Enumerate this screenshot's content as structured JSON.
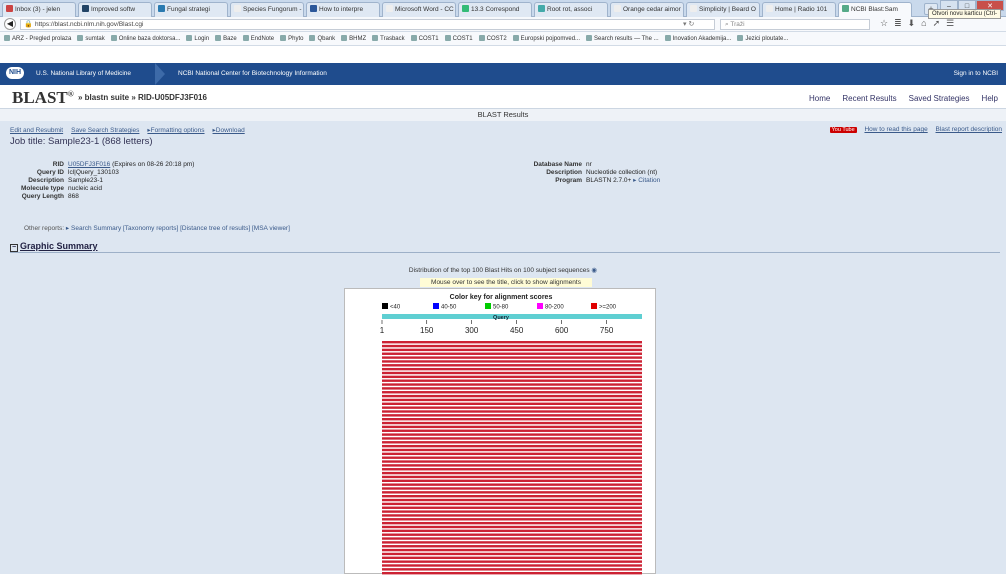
{
  "browser": {
    "tabs": [
      {
        "label": "Inbox (3) - jelen",
        "color": "#c44"
      },
      {
        "label": "Improved softw",
        "color": "#246"
      },
      {
        "label": "Fungal strategi",
        "color": "#2a7ab0"
      },
      {
        "label": "Species Fungorum -",
        "color": "#eee"
      },
      {
        "label": "How to interpre",
        "color": "#2b579a"
      },
      {
        "label": "Microsoft Word - CC",
        "color": "#eee"
      },
      {
        "label": "13.3 Correspond",
        "color": "#3b7"
      },
      {
        "label": "Root rot, associ",
        "color": "#4aa"
      },
      {
        "label": "Orange cedar aimor",
        "color": "#eee"
      },
      {
        "label": "Simplicity | Beard O",
        "color": "#eee"
      },
      {
        "label": "Home | Radio 101",
        "color": "#eee"
      },
      {
        "label": "NCBI Blast:Sam",
        "color": "#5a8"
      }
    ],
    "new_tab": "+",
    "tooltip": "Otvori novu karticu (Ctrl-",
    "url": "https://blast.ncbi.nlm.nih.gov/Blast.cgi",
    "search_placeholder": "Traži",
    "bookmarks": [
      "ARZ - Pregled prolaza",
      "sumtak",
      "Online baza doktorsa...",
      "Login",
      "Baze",
      "EndNote",
      "Phyto",
      "Qbank",
      "BHMZ",
      "Trasback",
      "COST1",
      "COST1",
      "COST2",
      "Europski pojpomved...",
      "Search results — The ...",
      "Inovation Akademija...",
      "Jezici ploutate..."
    ]
  },
  "ncbi": {
    "nih": "NIH",
    "nlm": "U.S. National Library of Medicine",
    "ncbi": "NCBI  National Center for Biotechnology Information",
    "signin": "Sign in to NCBI"
  },
  "blast": {
    "logo": "BLAST",
    "logo_sup": "®",
    "crumbs": "» blastn suite » RID-U05DFJ3F016",
    "links": [
      "Home",
      "Recent Results",
      "Saved Strategies",
      "Help"
    ],
    "results_title": "BLAST Results"
  },
  "content": {
    "actions": [
      "Edit and Resubmit",
      "Save Search Strategies",
      "▸Formatting options",
      "▸Download"
    ],
    "yt": "You Tube",
    "howto": "How to read this page",
    "blastreport": "Blast report description",
    "job_title": "Job title: Sample23-1 (868 letters)",
    "left_info": [
      {
        "k": "RID",
        "v": "U05DFJ3F016",
        "extra": " (Expires on 08-26 20:18 pm)"
      },
      {
        "k": "Query ID",
        "v": "lcl|Query_130103"
      },
      {
        "k": "Description",
        "v": "Sample23-1"
      },
      {
        "k": "Molecule type",
        "v": "nucleic acid"
      },
      {
        "k": "Query Length",
        "v": "868"
      }
    ],
    "right_info": [
      {
        "k": "Database Name",
        "v": "nr"
      },
      {
        "k": "Description",
        "v": "Nucleotide collection (nt)"
      },
      {
        "k": "Program",
        "v": "BLASTN 2.7.0+",
        "extra": " ▸ Citation"
      }
    ],
    "other_label": "Other reports:",
    "other_links": "▸ Search Summary [Taxonomy reports] [Distance tree of results] [MSA viewer]",
    "graphic_summary": "Graphic Summary",
    "distribution": "Distribution of the top 100 Blast Hits on 100 subject sequences",
    "mouse_over": "Mouse over to see the title, click to show alignments"
  },
  "chart_data": {
    "type": "bar",
    "title": "Color key for alignment scores",
    "key": [
      {
        "label": "<40",
        "color": "#000000"
      },
      {
        "label": "40-50",
        "color": "#0000ff"
      },
      {
        "label": "50-80",
        "color": "#00cc00"
      },
      {
        "label": "80-200",
        "color": "#ff00ff"
      },
      {
        "label": ">=200",
        "color": "#e00000"
      }
    ],
    "query_label": "Query",
    "ticks": [
      1,
      150,
      300,
      450,
      600,
      750
    ],
    "query_length": 868,
    "hits": 100,
    "visible_hits": 61,
    "hit_color": "#cc2233"
  }
}
